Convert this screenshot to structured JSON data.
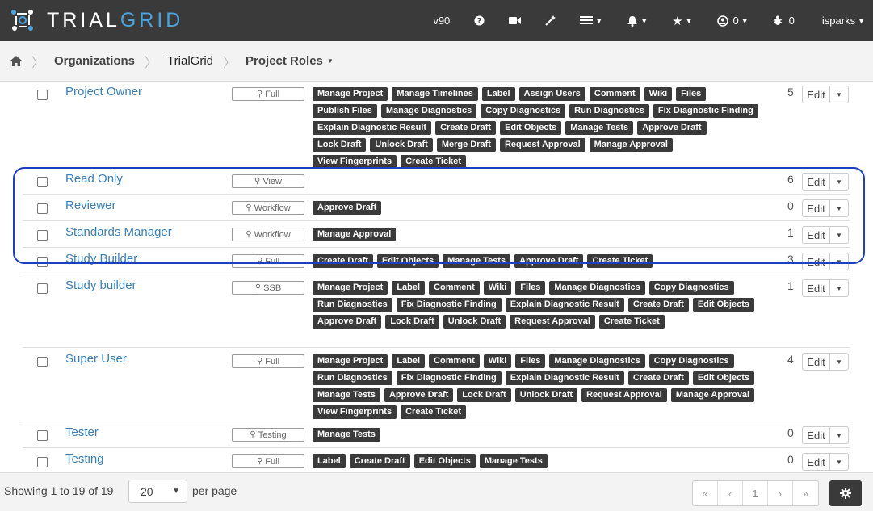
{
  "navbar": {
    "logo": {
      "part1": "TRIAL",
      "part2": "GRID"
    },
    "version": "v90",
    "alerts_count": "0",
    "bug_count": "0",
    "user": "isparks"
  },
  "breadcrumb": {
    "organizations": "Organizations",
    "trialgrid": "TrialGrid",
    "project_roles": "Project Roles"
  },
  "roles": [
    {
      "name": "Project Owner",
      "access": "Full",
      "count": "5",
      "permissions": [
        "Manage Project",
        "Manage Timelines",
        "Label",
        "Assign Users",
        "Comment",
        "Wiki",
        "Files",
        "Publish Files",
        "Manage Diagnostics",
        "Copy Diagnostics",
        "Run Diagnostics",
        "Fix Diagnostic Finding",
        "Explain Diagnostic Result",
        "Create Draft",
        "Edit Objects",
        "Manage Tests",
        "Approve Draft",
        "Lock Draft",
        "Unlock Draft",
        "Merge Draft",
        "Request Approval",
        "Manage Approval",
        "View Fingerprints",
        "Create Ticket"
      ]
    },
    {
      "name": "Read Only",
      "access": "View",
      "count": "6",
      "permissions": []
    },
    {
      "name": "Reviewer",
      "access": "Workflow",
      "count": "0",
      "permissions": [
        "Approve Draft"
      ]
    },
    {
      "name": "Standards Manager",
      "access": "Workflow",
      "count": "1",
      "permissions": [
        "Manage Approval"
      ]
    },
    {
      "name": "Study Builder",
      "access": "Full",
      "count": "3",
      "permissions": [
        "Create Draft",
        "Edit Objects",
        "Manage Tests",
        "Approve Draft",
        "Create Ticket"
      ]
    },
    {
      "name": "Study builder",
      "access": "SSB",
      "count": "1",
      "permissions": [
        "Manage Project",
        "Label",
        "Comment",
        "Wiki",
        "Files",
        "Manage Diagnostics",
        "Copy Diagnostics",
        "Run Diagnostics",
        "Fix Diagnostic Finding",
        "Explain Diagnostic Result",
        "Create Draft",
        "Edit Objects",
        "Approve Draft",
        "Lock Draft",
        "Unlock Draft",
        "Request Approval",
        "Create Ticket"
      ]
    },
    {
      "name": "Super User",
      "access": "Full",
      "count": "4",
      "permissions": [
        "Manage Project",
        "Label",
        "Comment",
        "Wiki",
        "Files",
        "Manage Diagnostics",
        "Copy Diagnostics",
        "Run Diagnostics",
        "Fix Diagnostic Finding",
        "Explain Diagnostic Result",
        "Create Draft",
        "Edit Objects",
        "Manage Tests",
        "Approve Draft",
        "Lock Draft",
        "Unlock Draft",
        "Request Approval",
        "Manage Approval",
        "View Fingerprints",
        "Create Ticket"
      ]
    },
    {
      "name": "Tester",
      "access": "Testing",
      "count": "0",
      "permissions": [
        "Manage Tests"
      ]
    },
    {
      "name": "Testing",
      "access": "Full",
      "count": "0",
      "permissions": [
        "Label",
        "Create Draft",
        "Edit Objects",
        "Manage Tests"
      ]
    }
  ],
  "labels": {
    "edit": "Edit"
  },
  "footer": {
    "showing": "Showing 1 to 19 of 19",
    "page_size": "20",
    "per_page": "per page",
    "pager": {
      "first": "«",
      "prev": "‹",
      "current": "1",
      "next": "›",
      "last": "»"
    }
  }
}
